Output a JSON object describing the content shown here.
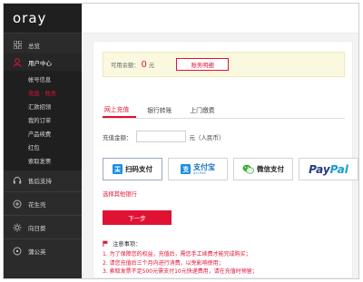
{
  "logo": {
    "text": "oray"
  },
  "sidebar": {
    "overview": {
      "label": "总览",
      "icon": "grid-icon"
    },
    "user_center": {
      "label": "用户中心",
      "icon": "user-icon"
    },
    "sub_items": [
      {
        "label": "帐号信息",
        "active": false
      },
      {
        "label": "充值 · 账务",
        "active": true
      },
      {
        "label": "汇款招领",
        "active": false
      },
      {
        "label": "我的订单",
        "active": false
      },
      {
        "label": "产品续费",
        "active": false
      },
      {
        "label": "红包",
        "active": false
      },
      {
        "label": "索取发票",
        "active": false
      }
    ],
    "lower": [
      {
        "label": "售后支持",
        "icon": "headset-icon"
      },
      {
        "label": "花生壳",
        "icon": "peanut-icon"
      },
      {
        "label": "向日葵",
        "icon": "sunflower-icon"
      },
      {
        "label": "蒲公英",
        "icon": "dandelion-icon"
      }
    ]
  },
  "balance": {
    "label": "可用余额：",
    "value": "0",
    "unit": "元",
    "detail_button": "账务明细"
  },
  "tabs": [
    {
      "label": "网上充值",
      "active": true
    },
    {
      "label": "银行转账",
      "active": false
    },
    {
      "label": "上门缴费",
      "active": false
    }
  ],
  "amount": {
    "label": "充值金额：",
    "value": "",
    "unit": "元（人民币）"
  },
  "payment_options": [
    {
      "label": "扫码支付",
      "icon": "scan-pay-icon",
      "selected": true
    },
    {
      "label": "支付宝",
      "sublabel": "ALIPAY",
      "icon": "alipay-icon",
      "selected": false
    },
    {
      "label": "微信支付",
      "icon": "wechat-icon",
      "selected": false
    },
    {
      "label_a": "Pay",
      "label_b": "Pal",
      "icon": "paypal-logo",
      "selected": false
    }
  ],
  "other_bank_link": "选择其他银行",
  "next_button": "下一步",
  "notes": {
    "title": "注意事项：",
    "items": [
      "1. 为了保障您的权益，充值后，需您手工续费才能完成购买；",
      "2. 请您充值后三个月内进行消费，以免影响使用；",
      "3. 索取发票不足500元需支付10元快递费用，请在充值时预留；"
    ]
  },
  "colors": {
    "accent": "#e01234",
    "sidebar_bg": "#2b2b2b",
    "balance_bg": "#fbf8e0"
  }
}
